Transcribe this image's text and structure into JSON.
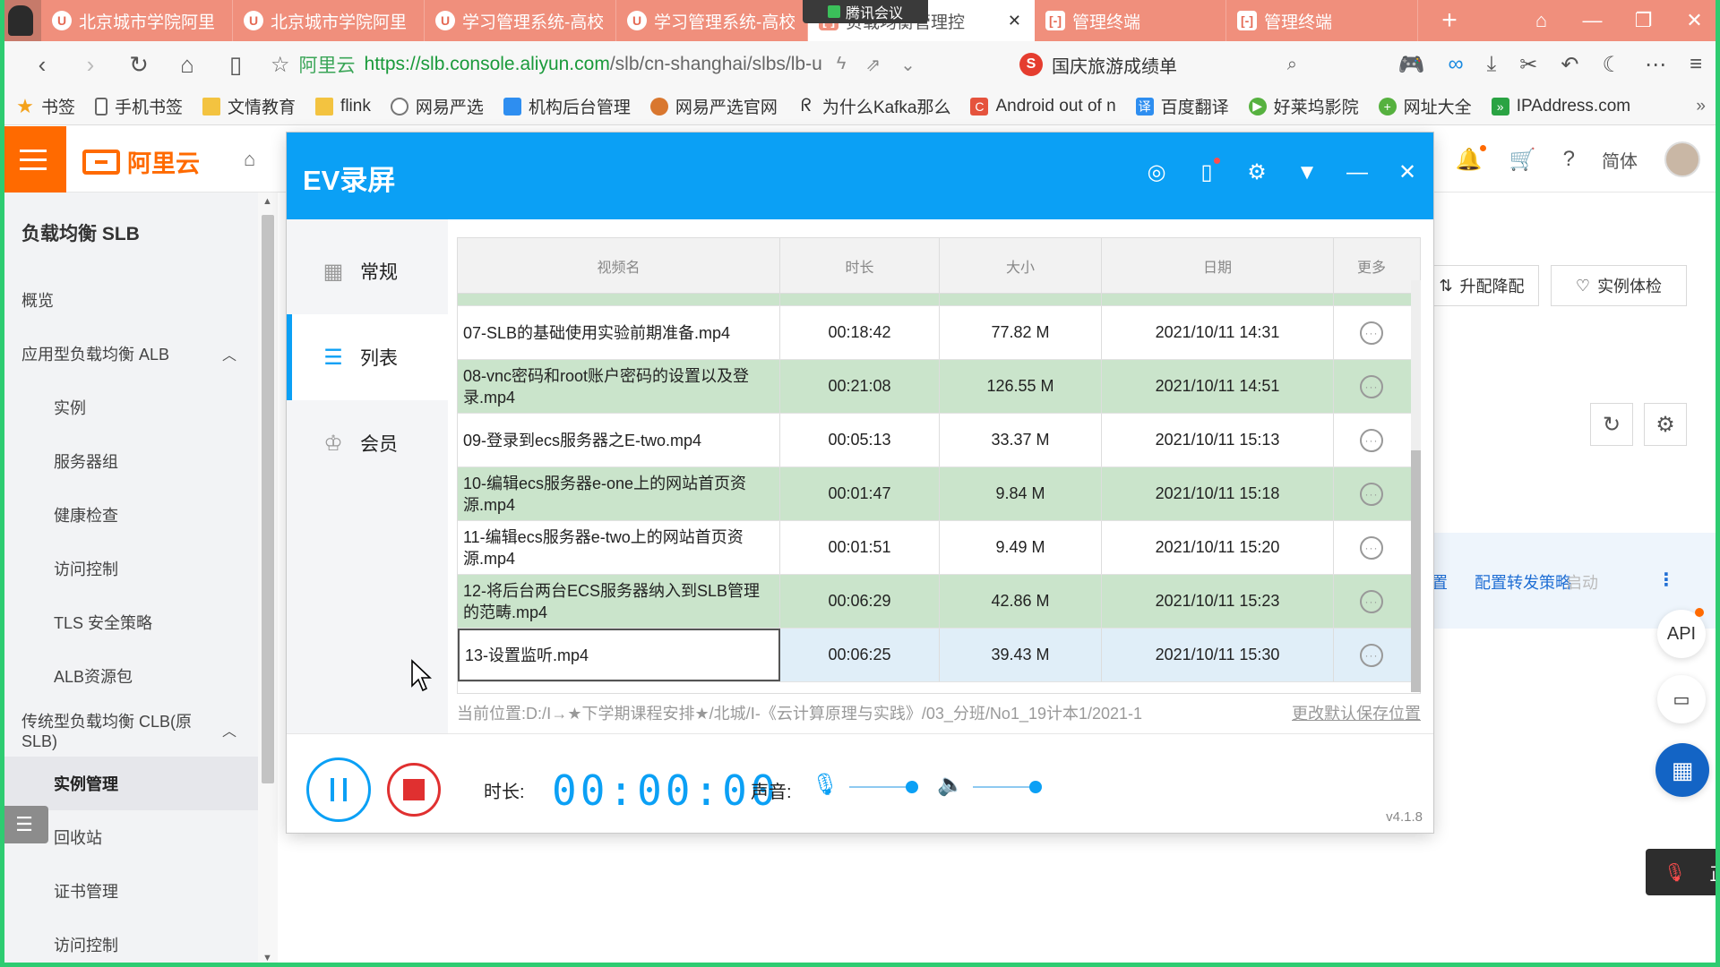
{
  "browser": {
    "tabs": [
      {
        "label": "北京城市学院阿里",
        "icon": "u"
      },
      {
        "label": "北京城市学院阿里",
        "icon": "u"
      },
      {
        "label": "学习管理系统-高校",
        "icon": "u"
      },
      {
        "label": "学习管理系统-高校",
        "icon": "u"
      },
      {
        "label": "负载均衡管理控",
        "icon": "aliyun",
        "active": true
      },
      {
        "label": "管理终端",
        "icon": "aliyun"
      },
      {
        "label": "管理终端",
        "icon": "aliyun"
      }
    ],
    "share_badge": "腾讯会议",
    "address": {
      "site_label": "阿里云",
      "url_main": "https://slb.console.aliyun.com",
      "url_rest": "/slb/cn-shanghai/slbs/lb-u"
    },
    "search_text": "国庆旅游成绩单",
    "bookmarks": [
      "书签",
      "手机书签",
      "文情教育",
      "flink",
      "网易严选",
      "机构后台管理",
      "网易严选官网",
      "为什么Kafka那么",
      "Android out of n",
      "百度翻译",
      "好莱坞影院",
      "网址大全",
      "IPAddress.com"
    ]
  },
  "console": {
    "lang": "简体",
    "sidebar": {
      "title": "负载均衡 SLB",
      "items": [
        {
          "label": "概览",
          "level": 0
        },
        {
          "label": "应用型负载均衡 ALB",
          "level": 0,
          "expand": "^"
        },
        {
          "label": "实例",
          "level": 1
        },
        {
          "label": "服务器组",
          "level": 1
        },
        {
          "label": "健康检查",
          "level": 1
        },
        {
          "label": "访问控制",
          "level": 1
        },
        {
          "label": "TLS 安全策略",
          "level": 1
        },
        {
          "label": "ALB资源包",
          "level": 1
        },
        {
          "label": "传统型负载均衡 CLB(原SLB)",
          "level": 0,
          "expand": "^"
        },
        {
          "label": "实例管理",
          "level": 1,
          "active": true
        },
        {
          "label": "回收站",
          "level": 1
        },
        {
          "label": "证书管理",
          "level": 1
        },
        {
          "label": "访问控制",
          "level": 1
        }
      ]
    },
    "buttons": {
      "upgrade": "升配降配",
      "check": "实例体检"
    },
    "row_actions": {
      "config": "置",
      "forward": "配置转发策略",
      "start": "启动"
    },
    "api_label": "API",
    "mic_float_text": "正"
  },
  "ev": {
    "title": "EV录屏",
    "nav": [
      {
        "label": "常规",
        "icon": "grid-icon"
      },
      {
        "label": "列表",
        "icon": "list-icon",
        "active": true
      },
      {
        "label": "会员",
        "icon": "crown-icon"
      }
    ],
    "columns": [
      "视频名",
      "时长",
      "大小",
      "日期",
      "更多"
    ],
    "rows": [
      {
        "name": "07-SLB的基础使用实验前期准备.mp4",
        "duration": "00:18:42",
        "size": "77.82 M",
        "date": "2021/10/11 14:31",
        "style": "w"
      },
      {
        "name": "08-vnc密码和root账户密码的设置以及登录.mp4",
        "duration": "00:21:08",
        "size": "126.55 M",
        "date": "2021/10/11 14:51",
        "style": "g"
      },
      {
        "name": "09-登录到ecs服务器之E-two.mp4",
        "duration": "00:05:13",
        "size": "33.37 M",
        "date": "2021/10/11 15:13",
        "style": "w"
      },
      {
        "name": "10-编辑ecs服务器e-one上的网站首页资源.mp4",
        "duration": "00:01:47",
        "size": "9.84 M",
        "date": "2021/10/11 15:18",
        "style": "g"
      },
      {
        "name": "11-编辑ecs服务器e-two上的网站首页资源.mp4",
        "duration": "00:01:51",
        "size": "9.49 M",
        "date": "2021/10/11 15:20",
        "style": "w"
      },
      {
        "name": "12-将后台两台ECS服务器纳入到SLB管理的范畴.mp4",
        "duration": "00:06:29",
        "size": "42.86 M",
        "date": "2021/10/11 15:23",
        "style": "g"
      },
      {
        "name": "13-设置监听.mp4",
        "duration": "00:06:25",
        "size": "39.43 M",
        "date": "2021/10/11 15:30",
        "style": "sel"
      }
    ],
    "path_label": "当前位置:",
    "path_value": "D:/Ⅰ→★下学期课程安排★/北城/Ⅰ-《云计算原理与实践》/03_分班/No1_19计本1/2021-1",
    "path_link": "更改默认保存位置",
    "duration_label": "时长:",
    "duration_value": "00:00:00",
    "sound_label": "声音:",
    "version": "v4.1.8"
  }
}
